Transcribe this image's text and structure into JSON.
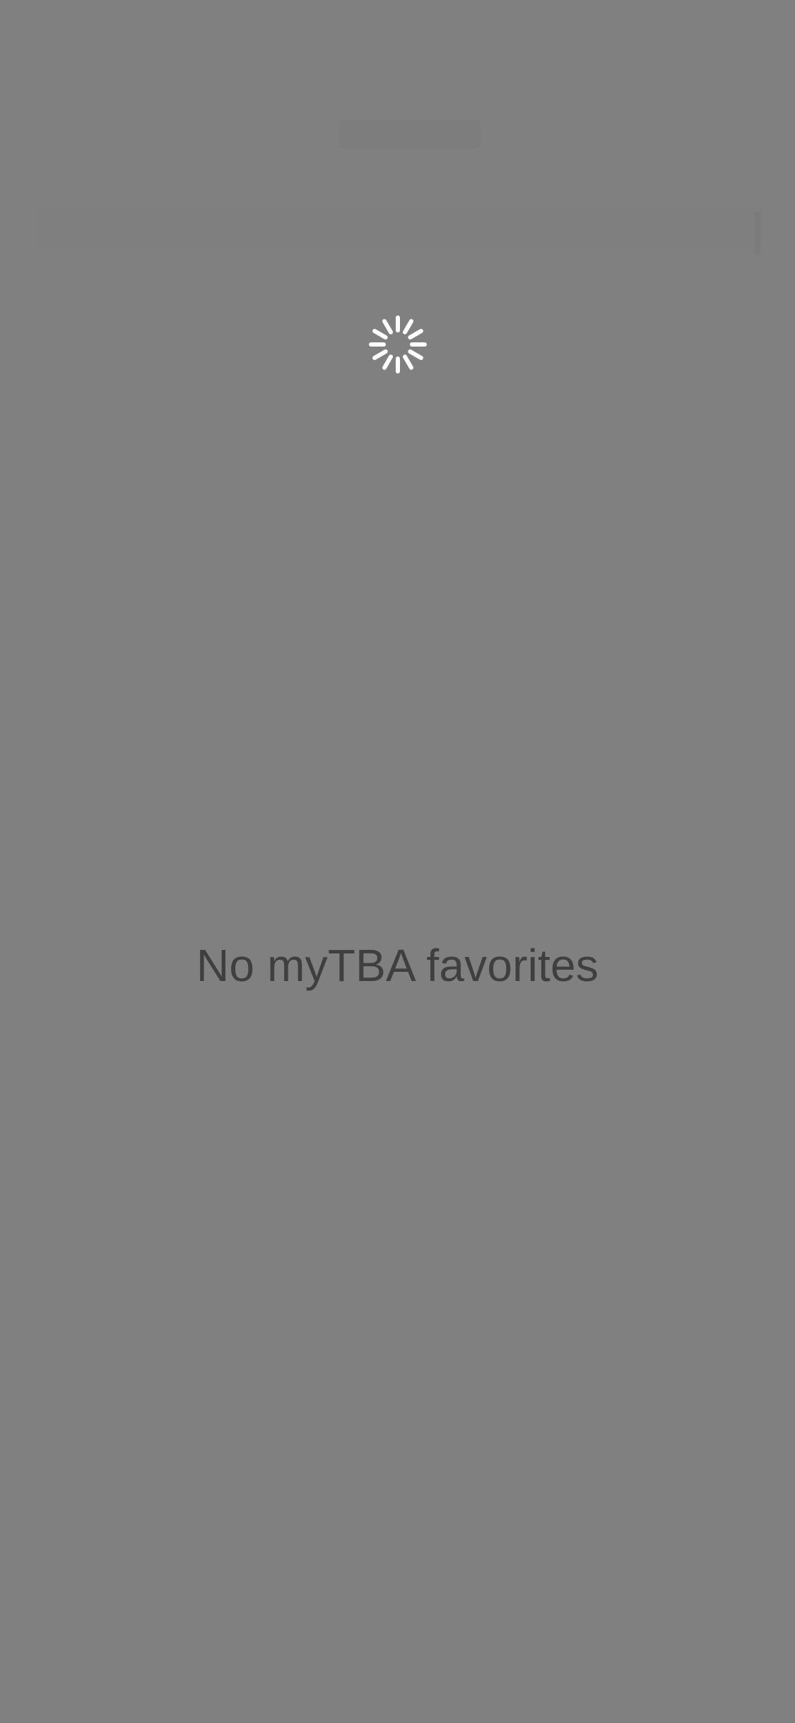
{
  "overlay": {
    "background_color": "#808080"
  },
  "loading": {
    "icon": "activity-spinner-icon",
    "spinner_color": "#ffffff"
  },
  "empty_state": {
    "message": "No myTBA favorites",
    "text_color": "#3f3f3f"
  }
}
